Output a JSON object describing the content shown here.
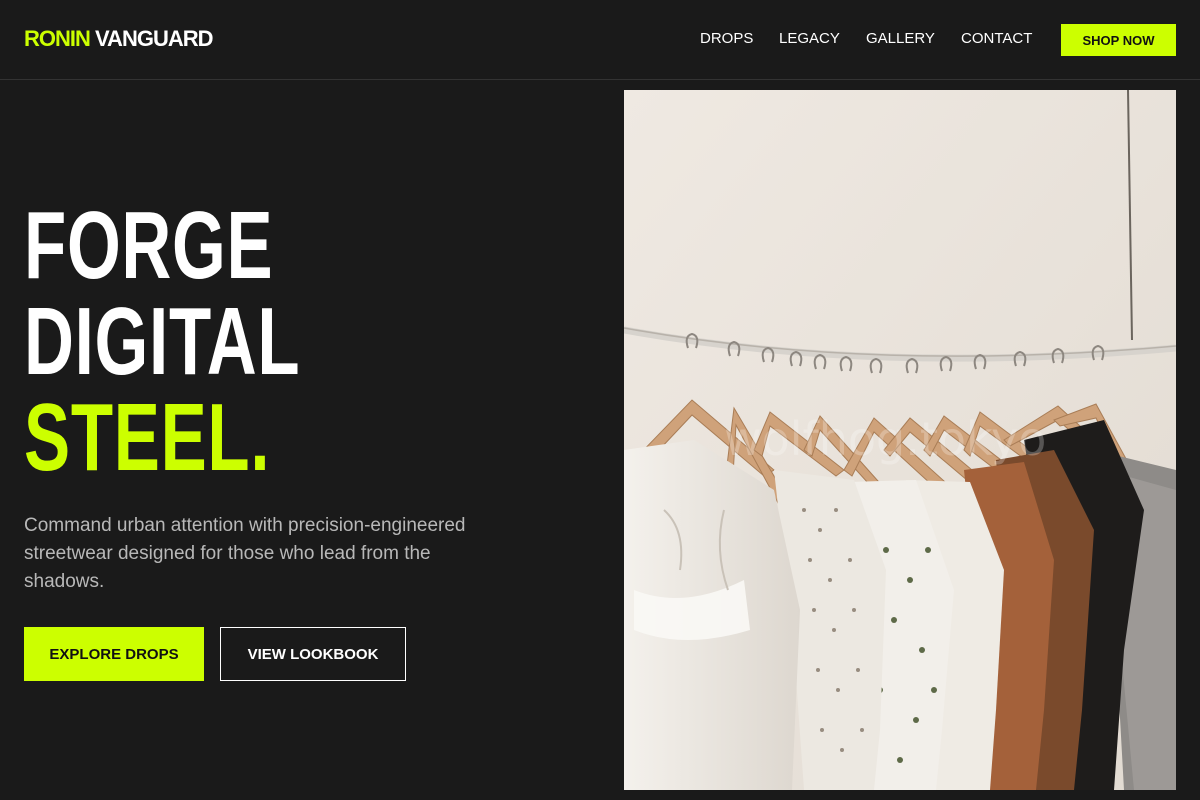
{
  "brand": {
    "accent_text": "RONIN",
    "rest_text": "VANGUARD"
  },
  "nav": {
    "items": [
      "DROPS",
      "LEGACY",
      "GALLERY",
      "CONTACT"
    ],
    "cta_label": "SHOP NOW"
  },
  "hero": {
    "title_lines": [
      "FORGE",
      "DIGITAL",
      "STEEL."
    ],
    "subtitle": "Command urban attention with precision-engineered streetwear designed for those who lead from the shadows.",
    "primary_button": "EXPLORE DROPS",
    "secondary_button": "VIEW LOOKBOOK",
    "image_watermark": "wolfhog.tokyo"
  },
  "colors": {
    "background": "#1a1a1a",
    "accent": "#ccff00",
    "text": "#ffffff",
    "muted_text": "#b8b8b8",
    "divider": "#333333"
  }
}
